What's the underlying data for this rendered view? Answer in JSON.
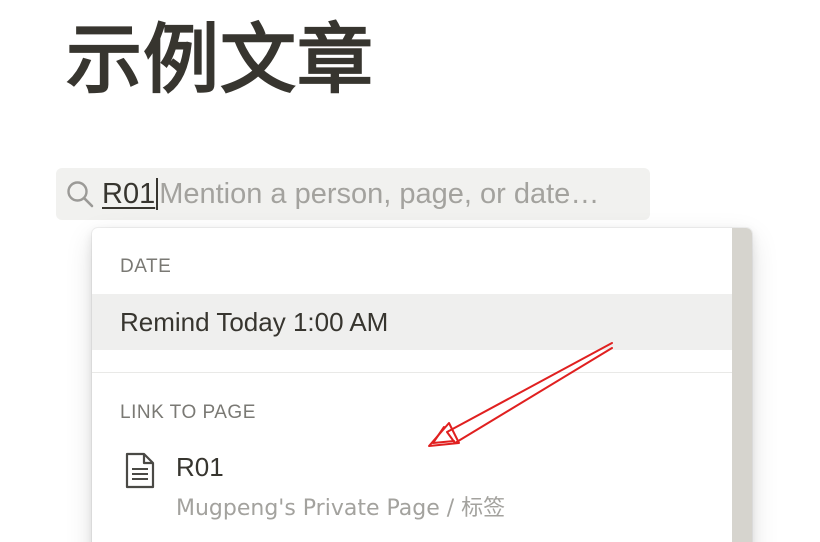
{
  "page": {
    "title": "示例文章"
  },
  "mention": {
    "query": "R01",
    "placeholder": "Mention a person, page, or date…"
  },
  "dropdown": {
    "date_section": {
      "label": "DATE",
      "option": "Remind Today 1:00 AM"
    },
    "link_section": {
      "label": "LINK TO PAGE",
      "items": [
        {
          "title": "R01",
          "path": "Mugpeng's Private Page / 标签",
          "icon": "page-icon"
        }
      ]
    }
  },
  "colors": {
    "text": "#37352f",
    "muted": "#a3a29e",
    "section_label": "#7a7974",
    "input_bg": "#f1f1ef",
    "highlight_bg": "#efefee",
    "scrollbar": "#d6d4ce",
    "annotation_arrow": "#e02020"
  }
}
